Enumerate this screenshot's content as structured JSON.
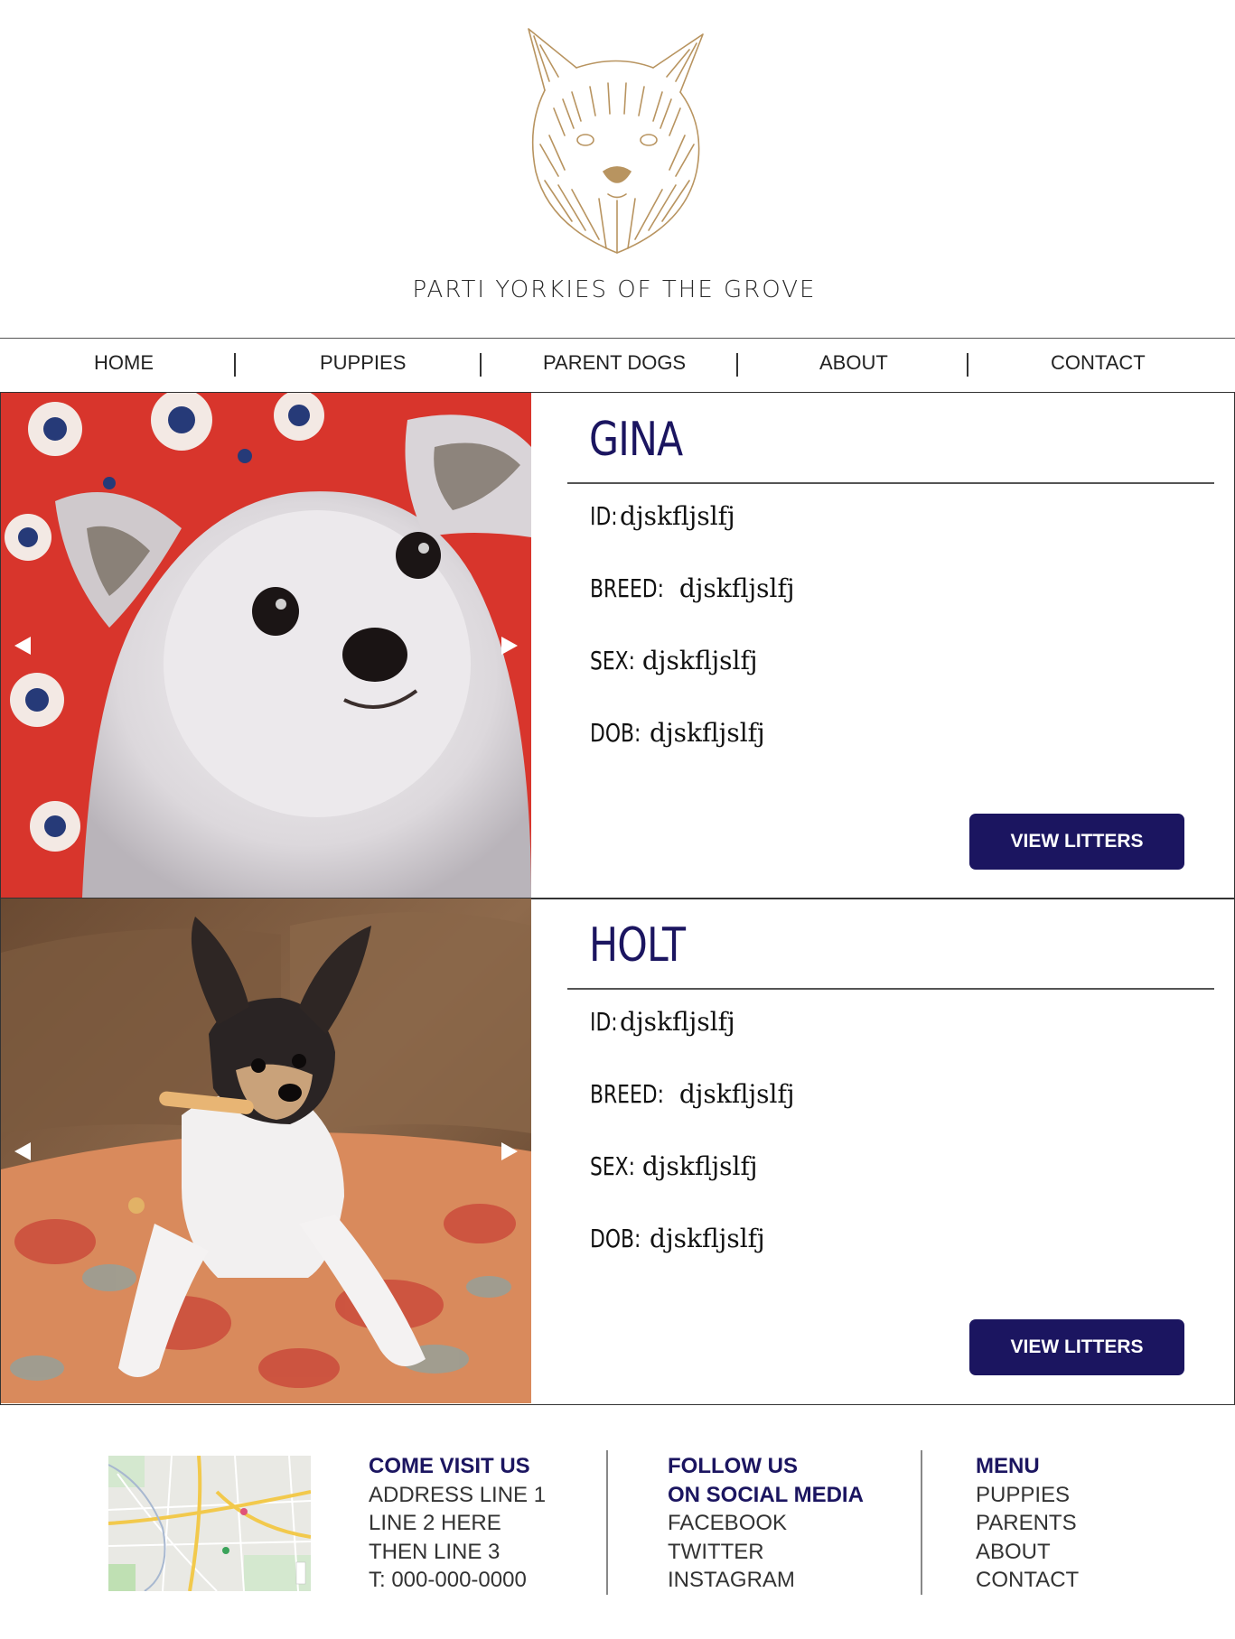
{
  "site": {
    "title": "PARTI YORKIES OF THE GROVE",
    "logo_icon": "yorkie-sketch-logo-icon",
    "accent_color": "#1b1560",
    "logo_color": "#b89460"
  },
  "nav": {
    "items": [
      {
        "label": "HOME"
      },
      {
        "label": "PUPPIES"
      },
      {
        "label": "PARENT DOGS"
      },
      {
        "label": "ABOUT"
      },
      {
        "label": "CONTACT"
      }
    ]
  },
  "dogs": [
    {
      "name": "GINA",
      "fields": [
        {
          "label": "ID:",
          "value": "djskfljslfj"
        },
        {
          "label": "BREED:",
          "value": "djskfljslfj"
        },
        {
          "label": "SEX:",
          "value": "djskfljslfj"
        },
        {
          "label": "DOB:",
          "value": "djskfljslfj"
        }
      ],
      "button_label": "VIEW LITTERS"
    },
    {
      "name": "HOLT",
      "fields": [
        {
          "label": "ID:",
          "value": "djskfljslfj"
        },
        {
          "label": "BREED:",
          "value": "djskfljslfj"
        },
        {
          "label": "SEX:",
          "value": "djskfljslfj"
        },
        {
          "label": "DOB:",
          "value": "djskfljslfj"
        }
      ],
      "button_label": "VIEW LITTERS"
    }
  ],
  "footer": {
    "visit": {
      "heading": "COME VISIT US",
      "lines": [
        "ADDRESS LINE 1",
        "LINE 2 HERE",
        "THEN LINE 3",
        "T: 000-000-0000"
      ]
    },
    "social": {
      "heading_lines": [
        "FOLLOW US",
        "ON SOCIAL MEDIA"
      ],
      "links": [
        "FACEBOOK",
        "TWITTER",
        "INSTAGRAM"
      ]
    },
    "menu": {
      "heading": "MENU",
      "links": [
        "PUPPIES",
        "PARENTS",
        "ABOUT",
        "CONTACT"
      ]
    }
  }
}
